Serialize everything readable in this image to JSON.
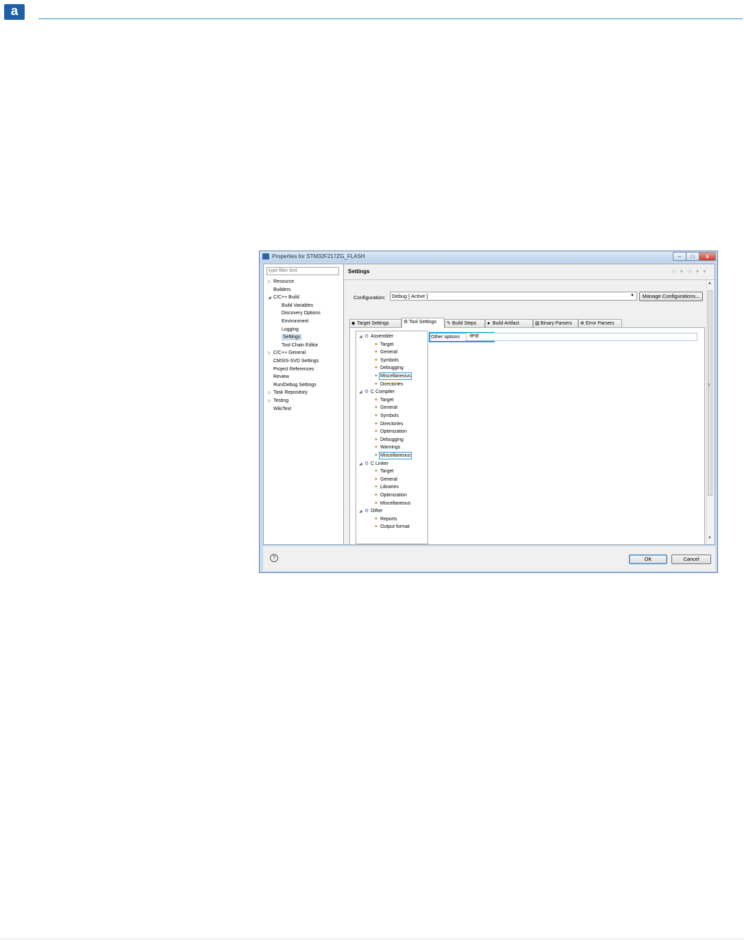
{
  "page": {
    "logo_letter": "a"
  },
  "window": {
    "title": "Properties for STM32F217ZG_FLASH",
    "controls": {
      "minimize": "–",
      "maximize": "□",
      "close": "x"
    }
  },
  "left_panel": {
    "filter_placeholder": "type filter text",
    "items": [
      {
        "label": "Resource",
        "twisty": "▷",
        "indent": 0
      },
      {
        "label": "Builders",
        "twisty": "",
        "indent": 0
      },
      {
        "label": "C/C++ Build",
        "twisty": "◢",
        "indent": 0
      },
      {
        "label": "Build Variables",
        "twisty": "",
        "indent": 1
      },
      {
        "label": "Discovery Options",
        "twisty": "",
        "indent": 1
      },
      {
        "label": "Environment",
        "twisty": "",
        "indent": 1
      },
      {
        "label": "Logging",
        "twisty": "",
        "indent": 1
      },
      {
        "label": "Settings",
        "twisty": "",
        "indent": 1,
        "selected": true
      },
      {
        "label": "Tool Chain Editor",
        "twisty": "",
        "indent": 1
      },
      {
        "label": "C/C++ General",
        "twisty": "▷",
        "indent": 0
      },
      {
        "label": "CMSIS-SVD Settings",
        "twisty": "",
        "indent": 0
      },
      {
        "label": "Project References",
        "twisty": "",
        "indent": 0
      },
      {
        "label": "Review",
        "twisty": "",
        "indent": 0
      },
      {
        "label": "Run/Debug Settings",
        "twisty": "",
        "indent": 0
      },
      {
        "label": "Task Repository",
        "twisty": "▷",
        "indent": 0
      },
      {
        "label": "Testing",
        "twisty": "▷",
        "indent": 0
      },
      {
        "label": "WikiText",
        "twisty": "",
        "indent": 0
      }
    ]
  },
  "main": {
    "title": "Settings",
    "nav_arrows": "⇦ ▾ ⇨ ▾ ▾",
    "configuration_label": "Configuration:",
    "configuration_value": "Debug  [ Active ]",
    "manage_button": "Manage Configurations...",
    "tabs": [
      {
        "label": "Target Settings",
        "icon": "◆"
      },
      {
        "label": "Tool Settings",
        "icon": "⚙",
        "active": true
      },
      {
        "label": "Build Steps",
        "icon": "✎"
      },
      {
        "label": "Build Artifact",
        "icon": "●"
      },
      {
        "label": "Binary Parsers",
        "icon": "▥"
      },
      {
        "label": "Error Parsers",
        "icon": "⊗"
      }
    ],
    "tool_tree": [
      {
        "label": "Assembler",
        "group": true
      },
      {
        "label": "Target"
      },
      {
        "label": "General"
      },
      {
        "label": "Symbols"
      },
      {
        "label": "Debugging"
      },
      {
        "label": "Miscellaneous",
        "highlighted": true
      },
      {
        "label": "Directories"
      },
      {
        "label": "C Compiler",
        "group": true
      },
      {
        "label": "Target"
      },
      {
        "label": "General"
      },
      {
        "label": "Symbols"
      },
      {
        "label": "Directories"
      },
      {
        "label": "Optimization"
      },
      {
        "label": "Debugging"
      },
      {
        "label": "Warnings"
      },
      {
        "label": "Miscellaneous",
        "highlighted": true
      },
      {
        "label": "C Linker",
        "group": true
      },
      {
        "label": "Target"
      },
      {
        "label": "General"
      },
      {
        "label": "Libraries"
      },
      {
        "label": "Optimization"
      },
      {
        "label": "Miscellaneous"
      },
      {
        "label": "Other",
        "group": true
      },
      {
        "label": "Reports"
      },
      {
        "label": "Output format"
      }
    ],
    "other_options_label": "Other options",
    "other_options_value": "-fPIE"
  },
  "footer": {
    "help": "?",
    "ok": "OK",
    "cancel": "Cancel"
  },
  "colors": {
    "highlight": "#1e9be0",
    "logo": "#1f5fa8",
    "rule": "#2a8fc9"
  }
}
